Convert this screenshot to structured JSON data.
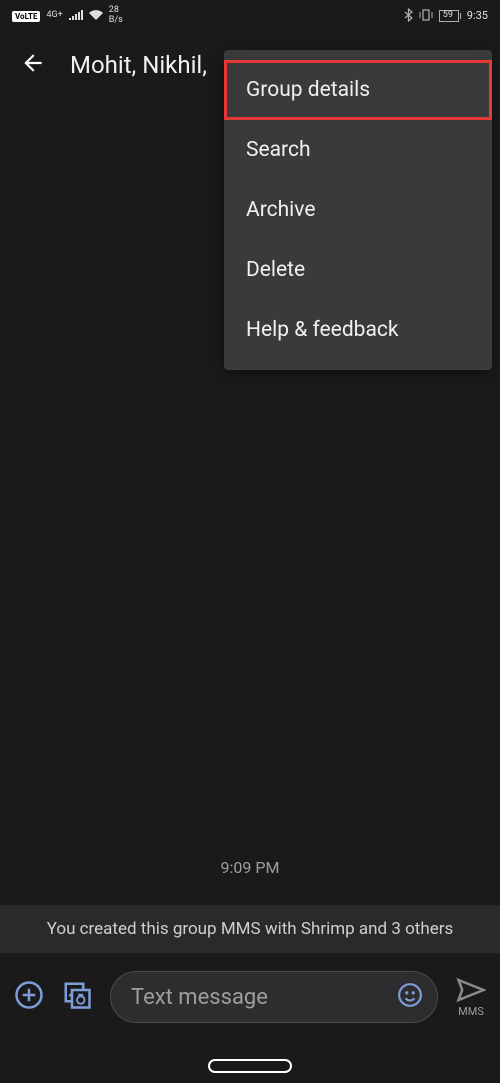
{
  "status_bar": {
    "volte": "VoLTE",
    "signal_label": "4G+",
    "data_rate": "28",
    "data_unit": "B/s",
    "battery": "59",
    "time": "9:35"
  },
  "header": {
    "title": "Mohit, Nikhil,"
  },
  "menu": {
    "items": [
      {
        "label": "Group details",
        "highlighted": true
      },
      {
        "label": "Search",
        "highlighted": false
      },
      {
        "label": "Archive",
        "highlighted": false
      },
      {
        "label": "Delete",
        "highlighted": false
      },
      {
        "label": "Help & feedback",
        "highlighted": false
      }
    ]
  },
  "chat": {
    "timestamp": "9:09 PM",
    "system_message": "You created this group MMS with Shrimp  and 3 others"
  },
  "compose": {
    "placeholder": "Text message",
    "send_label": "MMS"
  }
}
